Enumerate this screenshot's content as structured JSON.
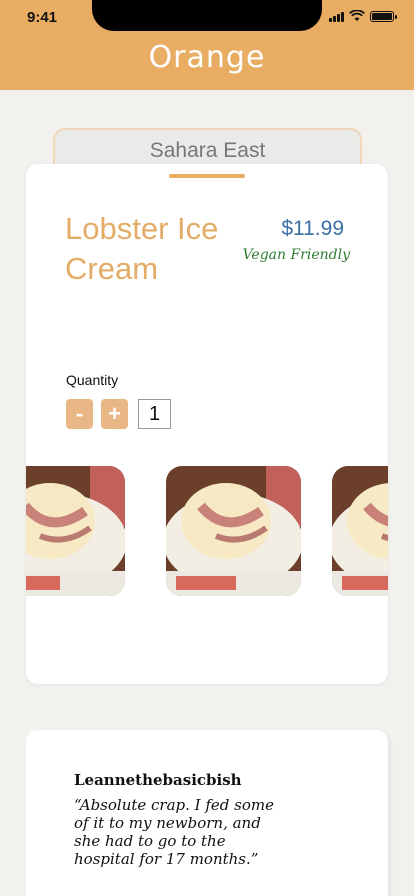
{
  "status_bar": {
    "time": "9:41"
  },
  "header": {
    "brand": "Orange"
  },
  "venue": {
    "name": "Sahara East"
  },
  "item": {
    "name": "Lobster Ice Cream",
    "price": "$11.99",
    "tag": "Vegan Friendly"
  },
  "quantity": {
    "label": "Quantity",
    "minus": "-",
    "plus": "+",
    "value": "1"
  },
  "gallery": {
    "count": 3
  },
  "review": {
    "author": "Leannethebasicbish",
    "text": "“Absolute crap. I fed some of it to my newborn, and she had to go to the hospital for 17 months.”"
  },
  "colors": {
    "accent": "#e8ac63",
    "price": "#3a6fa7",
    "vegan": "#2e7d32"
  }
}
